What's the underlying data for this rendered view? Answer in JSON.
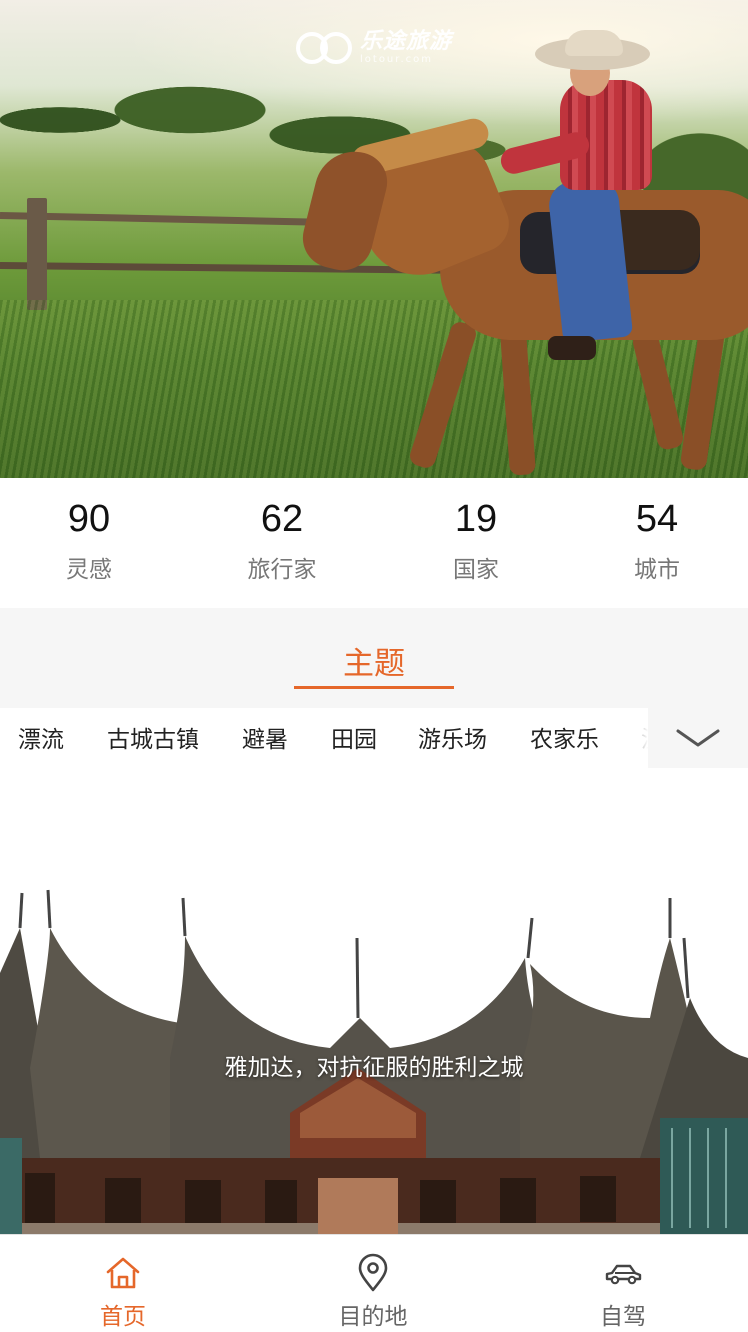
{
  "brand": {
    "logo_text": "乐途旅游",
    "logo_sub": "lotour.com"
  },
  "stats": [
    {
      "value": "90",
      "label": "灵感"
    },
    {
      "value": "62",
      "label": "旅行家"
    },
    {
      "value": "19",
      "label": "国家"
    },
    {
      "value": "54",
      "label": "城市"
    }
  ],
  "theme": {
    "title": "主题",
    "tabs": [
      "漂流",
      "古城古镇",
      "避暑",
      "田园",
      "游乐场",
      "农家乐",
      "温泉"
    ]
  },
  "feature": {
    "caption": "雅加达，对抗征服的胜利之城"
  },
  "bottom_nav": [
    {
      "label": "首页",
      "icon": "home-icon",
      "active": true
    },
    {
      "label": "目的地",
      "icon": "location-pin-icon",
      "active": false
    },
    {
      "label": "自驾",
      "icon": "car-icon",
      "active": false
    }
  ],
  "colors": {
    "accent": "#e5672a",
    "inactive": "#666666",
    "stat_label": "#777777",
    "section_bg": "#f6f6f6"
  }
}
